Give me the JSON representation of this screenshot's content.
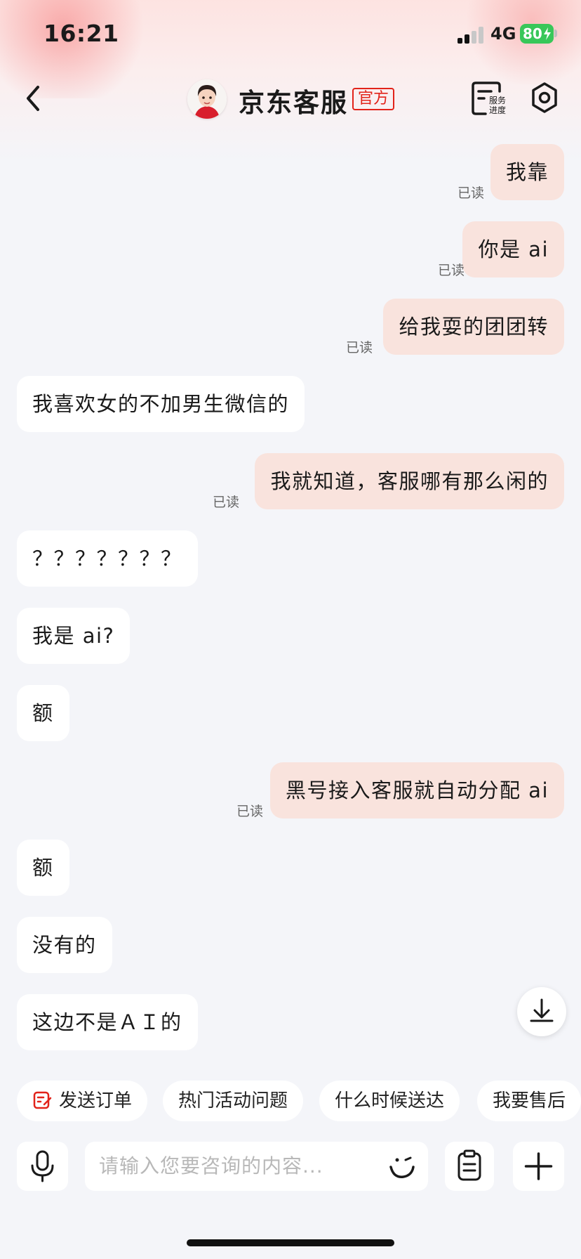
{
  "status_bar": {
    "time": "16:21",
    "network": "4G",
    "battery": "80"
  },
  "header": {
    "title": "京东客服",
    "badge": "官方",
    "service_progress_label": [
      "服务",
      "进度"
    ]
  },
  "messages": [
    {
      "side": "right",
      "text": "我靠",
      "status": "已读"
    },
    {
      "side": "right",
      "text": "你是 ai",
      "status": "已读"
    },
    {
      "side": "right",
      "text": "给我耍的团团转",
      "status": "已读"
    },
    {
      "side": "left",
      "text": "我喜欢女的不加男生微信的"
    },
    {
      "side": "right",
      "text": "我就知道，客服哪有那么闲的",
      "status": "已读"
    },
    {
      "side": "left",
      "text": "？？？？？？？"
    },
    {
      "side": "left",
      "text": "我是 ai?"
    },
    {
      "side": "left",
      "text": "额"
    },
    {
      "side": "right",
      "text": "黑号接入客服就自动分配 ai",
      "status": "已读"
    },
    {
      "side": "left",
      "text": "额"
    },
    {
      "side": "left",
      "text": "没有的"
    },
    {
      "side": "left",
      "text": "这边不是ＡＩ的"
    }
  ],
  "quick_replies": [
    "发送订单",
    "热门活动问题",
    "什么时候送达",
    "我要售后"
  ],
  "input": {
    "placeholder": "请输入您要咨询的内容..."
  },
  "colors": {
    "accent": "#e2231a",
    "outgoing_bubble": "#f9e3dd",
    "incoming_bubble": "#ffffff",
    "battery": "#38c759"
  }
}
